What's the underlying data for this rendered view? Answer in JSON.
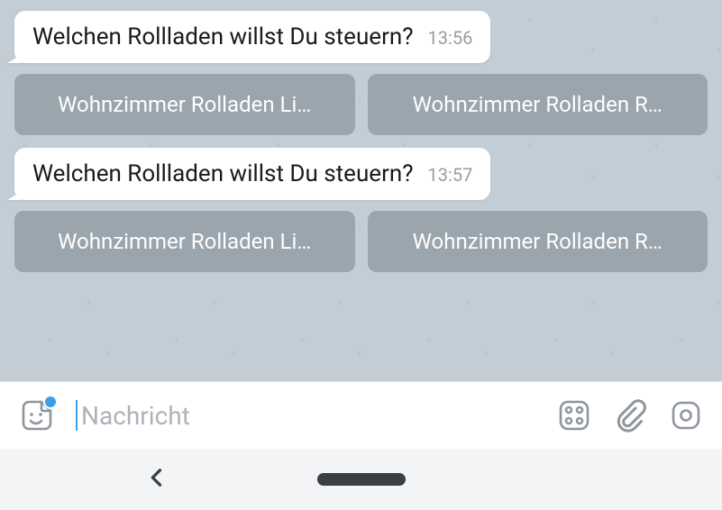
{
  "messages": [
    {
      "text": "Welchen Rollladen willst Du steuern?",
      "time": "13:56",
      "buttons": [
        {
          "label": "Wohnzimmer Rolladen Li…"
        },
        {
          "label": "Wohnzimmer Rolladen R…"
        }
      ]
    },
    {
      "text": "Welchen Rollladen willst Du steuern?",
      "time": "13:57",
      "buttons": [
        {
          "label": "Wohnzimmer Rolladen Li…"
        },
        {
          "label": "Wohnzimmer Rolladen R…"
        }
      ]
    }
  ],
  "composer": {
    "placeholder": "Nachricht"
  }
}
